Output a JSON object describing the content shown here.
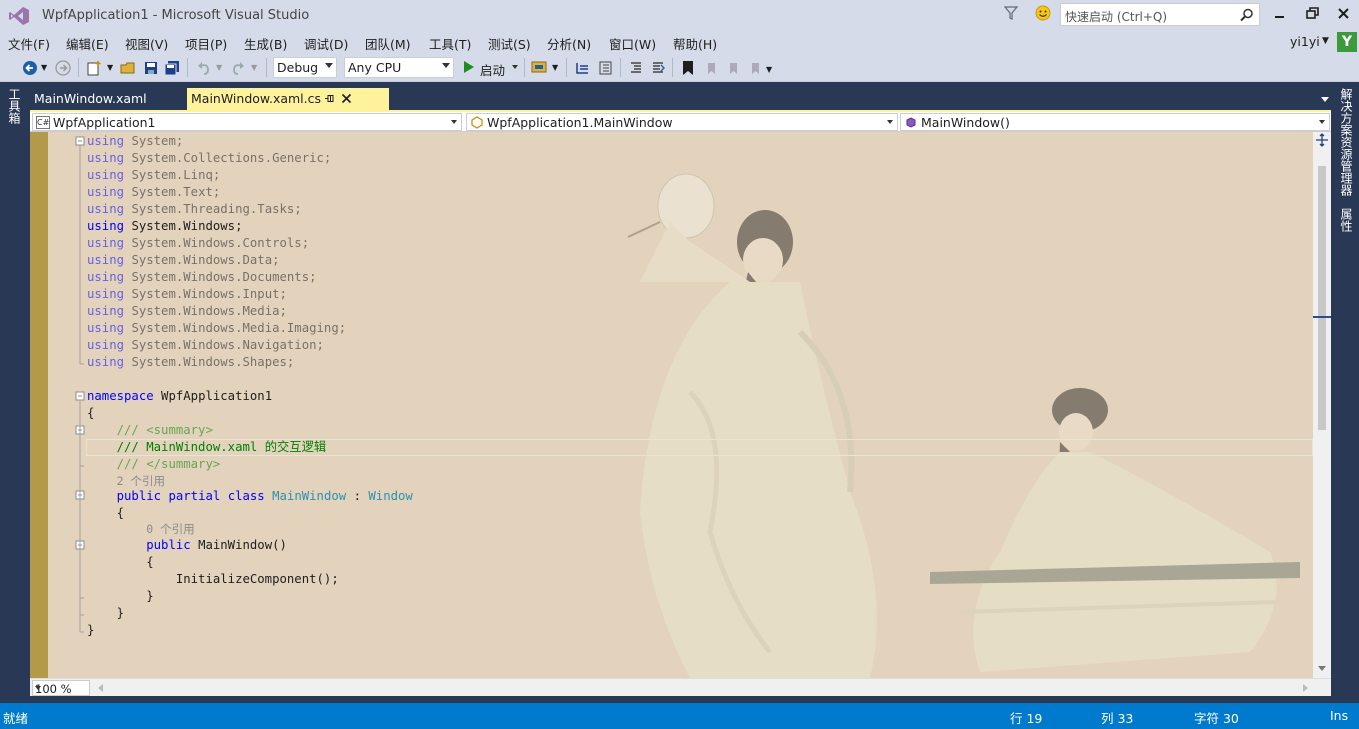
{
  "window": {
    "title": "WpfApplication1 - Microsoft Visual Studio",
    "quick_launch_placeholder": "快速启动 (Ctrl+Q)",
    "user": "yi1yi",
    "user_badge": "Y"
  },
  "menu": [
    "文件(F)",
    "编辑(E)",
    "视图(V)",
    "项目(P)",
    "生成(B)",
    "调试(D)",
    "团队(M)",
    "工具(T)",
    "测试(S)",
    "分析(N)",
    "窗口(W)",
    "帮助(H)"
  ],
  "toolbar": {
    "config": "Debug",
    "platform": "Any CPU",
    "start_label": "启动"
  },
  "side_tabs": {
    "left": "工具箱",
    "right_solution": "解决方案资源管理器",
    "right_properties": "属性"
  },
  "tabs": {
    "inactive": "MainWindow.xaml",
    "active": "MainWindow.xaml.cs",
    "active_icon_glyph": "C#"
  },
  "navbar": {
    "project": "WpfApplication1",
    "class": "WpfApplication1.MainWindow",
    "member": "MainWindow()"
  },
  "code": {
    "using_kw": "using",
    "usings": [
      "System;",
      "System.Collections.Generic;",
      "System.Linq;",
      "System.Text;",
      "System.Threading.Tasks;",
      "System.Windows;",
      "System.Windows.Controls;",
      "System.Windows.Data;",
      "System.Windows.Documents;",
      "System.Windows.Input;",
      "System.Windows.Media;",
      "System.Windows.Media.Imaging;",
      "System.Windows.Navigation;",
      "System.Windows.Shapes;"
    ],
    "namespace_kw": "namespace",
    "namespace_name": "WpfApplication1",
    "open_brace": "{",
    "close_brace": "}",
    "summary_open": "/// <summary>",
    "summary_text": "/// MainWindow.xaml 的交互逻辑",
    "summary_close": "/// </summary>",
    "class_refs": "2 个引用",
    "class_mod_public": "public",
    "class_mod_partial": "partial",
    "class_kw": "class",
    "class_name": "MainWindow",
    "colon": ":",
    "base_class": "Window",
    "ctor_refs": "0 个引用",
    "ctor_public": "public",
    "ctor_sig": "MainWindow()",
    "ctor_body": "InitializeComponent();"
  },
  "editor": {
    "zoom": "100 %"
  },
  "status": {
    "ready": "就绪",
    "line": "行 19",
    "col": "列 33",
    "char": "字符 30",
    "mode": "Ins"
  }
}
